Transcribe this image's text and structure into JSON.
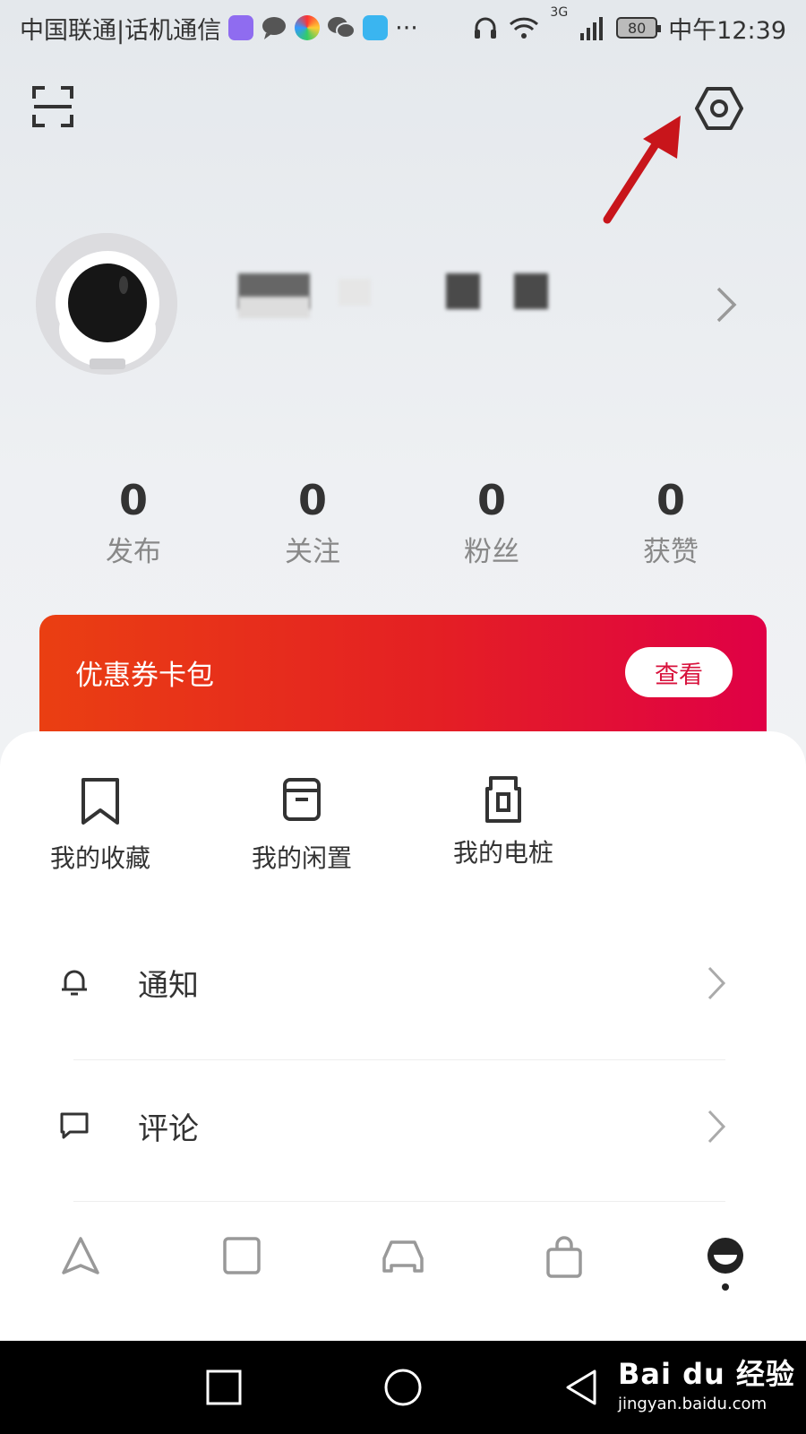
{
  "status_bar": {
    "carrier": "中国联通|话机通信",
    "more": "···",
    "network": "3G",
    "battery": "80",
    "time": "中午12:39"
  },
  "header": {
    "scan_icon": "scan-icon",
    "settings_icon": "settings-icon"
  },
  "profile": {
    "avatar": "astronaut-avatar",
    "chevron": "chevron-right-icon"
  },
  "stats": [
    {
      "value": "0",
      "label": "发布"
    },
    {
      "value": "0",
      "label": "关注"
    },
    {
      "value": "0",
      "label": "粉丝"
    },
    {
      "value": "0",
      "label": "获赞"
    }
  ],
  "coupon": {
    "title": "优惠券卡包",
    "button": "查看",
    "colors": {
      "start": "#ea3f12",
      "end": "#e00046"
    }
  },
  "quick_actions": [
    {
      "label": "我的收藏",
      "icon": "bookmark-icon"
    },
    {
      "label": "我的闲置",
      "icon": "box-icon"
    },
    {
      "label": "我的电桩",
      "icon": "charging-pile-icon"
    }
  ],
  "menu": [
    {
      "label": "通知",
      "icon": "bell-icon"
    },
    {
      "label": "评论",
      "icon": "comment-icon"
    }
  ],
  "tab_bar": [
    {
      "name": "navigate",
      "icon": "navigation-icon"
    },
    {
      "name": "square",
      "icon": "square-icon"
    },
    {
      "name": "car",
      "icon": "car-icon"
    },
    {
      "name": "shop",
      "icon": "bag-icon"
    },
    {
      "name": "me",
      "icon": "profile-face-icon",
      "active": true
    }
  ],
  "watermark": {
    "main": "Bai du 经验",
    "sub": "jingyan.baidu.com"
  }
}
